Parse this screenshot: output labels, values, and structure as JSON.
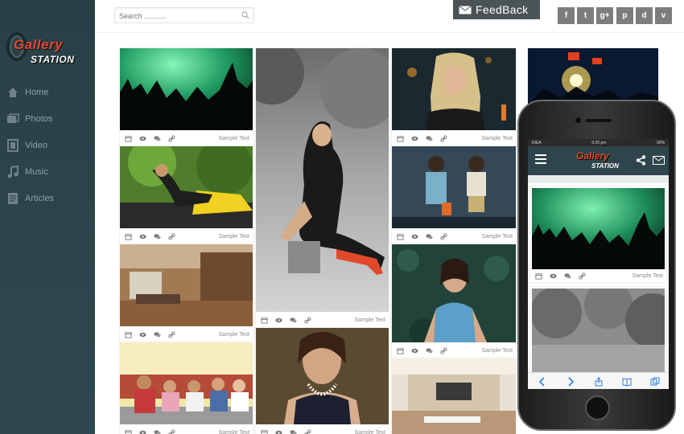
{
  "sidebar": {
    "logo": {
      "word1": "Gallery",
      "word2": "STATION"
    },
    "items": [
      {
        "label": "Home",
        "icon": "home-icon"
      },
      {
        "label": "Photos",
        "icon": "photos-icon"
      },
      {
        "label": "Video",
        "icon": "video-icon"
      },
      {
        "label": "Music",
        "icon": "music-icon"
      },
      {
        "label": "Articles",
        "icon": "articles-icon"
      }
    ]
  },
  "search": {
    "placeholder": "Search ..........."
  },
  "feedback": {
    "label": "FeedBack"
  },
  "social": [
    "f",
    "t",
    "g+",
    "p",
    "d",
    "v"
  ],
  "card_caption": "Sample Text",
  "mobile": {
    "carrier": "IDEA",
    "time": "9:20 pm",
    "battery": "90%",
    "logo": {
      "word1": "Gallery",
      "word2": "STATION"
    },
    "card_caption": "Sample Text"
  },
  "colors": {
    "sidebar": "#2f474e",
    "accent_logo": "#e24a2e",
    "feedback_bg": "#4b5356",
    "social_bg": "#7d7d7d"
  }
}
